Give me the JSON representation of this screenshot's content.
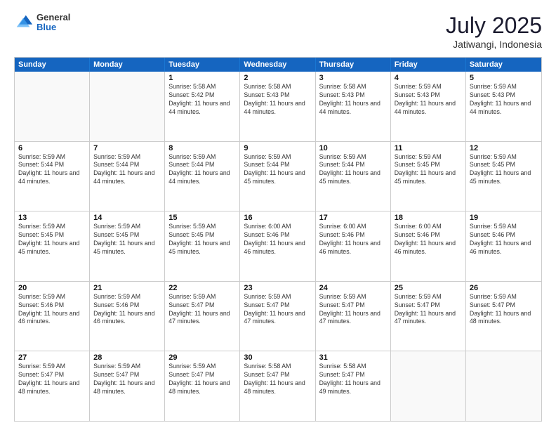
{
  "header": {
    "logo_general": "General",
    "logo_blue": "Blue",
    "month_year": "July 2025",
    "location": "Jatiwangi, Indonesia"
  },
  "days_of_week": [
    "Sunday",
    "Monday",
    "Tuesday",
    "Wednesday",
    "Thursday",
    "Friday",
    "Saturday"
  ],
  "weeks": [
    [
      {
        "day": "",
        "info": "",
        "empty": true
      },
      {
        "day": "",
        "info": "",
        "empty": true
      },
      {
        "day": "1",
        "info": "Sunrise: 5:58 AM\nSunset: 5:42 PM\nDaylight: 11 hours and 44 minutes."
      },
      {
        "day": "2",
        "info": "Sunrise: 5:58 AM\nSunset: 5:43 PM\nDaylight: 11 hours and 44 minutes."
      },
      {
        "day": "3",
        "info": "Sunrise: 5:58 AM\nSunset: 5:43 PM\nDaylight: 11 hours and 44 minutes."
      },
      {
        "day": "4",
        "info": "Sunrise: 5:59 AM\nSunset: 5:43 PM\nDaylight: 11 hours and 44 minutes."
      },
      {
        "day": "5",
        "info": "Sunrise: 5:59 AM\nSunset: 5:43 PM\nDaylight: 11 hours and 44 minutes."
      }
    ],
    [
      {
        "day": "6",
        "info": "Sunrise: 5:59 AM\nSunset: 5:44 PM\nDaylight: 11 hours and 44 minutes."
      },
      {
        "day": "7",
        "info": "Sunrise: 5:59 AM\nSunset: 5:44 PM\nDaylight: 11 hours and 44 minutes."
      },
      {
        "day": "8",
        "info": "Sunrise: 5:59 AM\nSunset: 5:44 PM\nDaylight: 11 hours and 44 minutes."
      },
      {
        "day": "9",
        "info": "Sunrise: 5:59 AM\nSunset: 5:44 PM\nDaylight: 11 hours and 45 minutes."
      },
      {
        "day": "10",
        "info": "Sunrise: 5:59 AM\nSunset: 5:44 PM\nDaylight: 11 hours and 45 minutes."
      },
      {
        "day": "11",
        "info": "Sunrise: 5:59 AM\nSunset: 5:45 PM\nDaylight: 11 hours and 45 minutes."
      },
      {
        "day": "12",
        "info": "Sunrise: 5:59 AM\nSunset: 5:45 PM\nDaylight: 11 hours and 45 minutes."
      }
    ],
    [
      {
        "day": "13",
        "info": "Sunrise: 5:59 AM\nSunset: 5:45 PM\nDaylight: 11 hours and 45 minutes."
      },
      {
        "day": "14",
        "info": "Sunrise: 5:59 AM\nSunset: 5:45 PM\nDaylight: 11 hours and 45 minutes."
      },
      {
        "day": "15",
        "info": "Sunrise: 5:59 AM\nSunset: 5:45 PM\nDaylight: 11 hours and 45 minutes."
      },
      {
        "day": "16",
        "info": "Sunrise: 6:00 AM\nSunset: 5:46 PM\nDaylight: 11 hours and 46 minutes."
      },
      {
        "day": "17",
        "info": "Sunrise: 6:00 AM\nSunset: 5:46 PM\nDaylight: 11 hours and 46 minutes."
      },
      {
        "day": "18",
        "info": "Sunrise: 6:00 AM\nSunset: 5:46 PM\nDaylight: 11 hours and 46 minutes."
      },
      {
        "day": "19",
        "info": "Sunrise: 5:59 AM\nSunset: 5:46 PM\nDaylight: 11 hours and 46 minutes."
      }
    ],
    [
      {
        "day": "20",
        "info": "Sunrise: 5:59 AM\nSunset: 5:46 PM\nDaylight: 11 hours and 46 minutes."
      },
      {
        "day": "21",
        "info": "Sunrise: 5:59 AM\nSunset: 5:46 PM\nDaylight: 11 hours and 46 minutes."
      },
      {
        "day": "22",
        "info": "Sunrise: 5:59 AM\nSunset: 5:47 PM\nDaylight: 11 hours and 47 minutes."
      },
      {
        "day": "23",
        "info": "Sunrise: 5:59 AM\nSunset: 5:47 PM\nDaylight: 11 hours and 47 minutes."
      },
      {
        "day": "24",
        "info": "Sunrise: 5:59 AM\nSunset: 5:47 PM\nDaylight: 11 hours and 47 minutes."
      },
      {
        "day": "25",
        "info": "Sunrise: 5:59 AM\nSunset: 5:47 PM\nDaylight: 11 hours and 47 minutes."
      },
      {
        "day": "26",
        "info": "Sunrise: 5:59 AM\nSunset: 5:47 PM\nDaylight: 11 hours and 48 minutes."
      }
    ],
    [
      {
        "day": "27",
        "info": "Sunrise: 5:59 AM\nSunset: 5:47 PM\nDaylight: 11 hours and 48 minutes."
      },
      {
        "day": "28",
        "info": "Sunrise: 5:59 AM\nSunset: 5:47 PM\nDaylight: 11 hours and 48 minutes."
      },
      {
        "day": "29",
        "info": "Sunrise: 5:59 AM\nSunset: 5:47 PM\nDaylight: 11 hours and 48 minutes."
      },
      {
        "day": "30",
        "info": "Sunrise: 5:58 AM\nSunset: 5:47 PM\nDaylight: 11 hours and 48 minutes."
      },
      {
        "day": "31",
        "info": "Sunrise: 5:58 AM\nSunset: 5:47 PM\nDaylight: 11 hours and 49 minutes."
      },
      {
        "day": "",
        "info": "",
        "empty": true
      },
      {
        "day": "",
        "info": "",
        "empty": true
      }
    ]
  ]
}
